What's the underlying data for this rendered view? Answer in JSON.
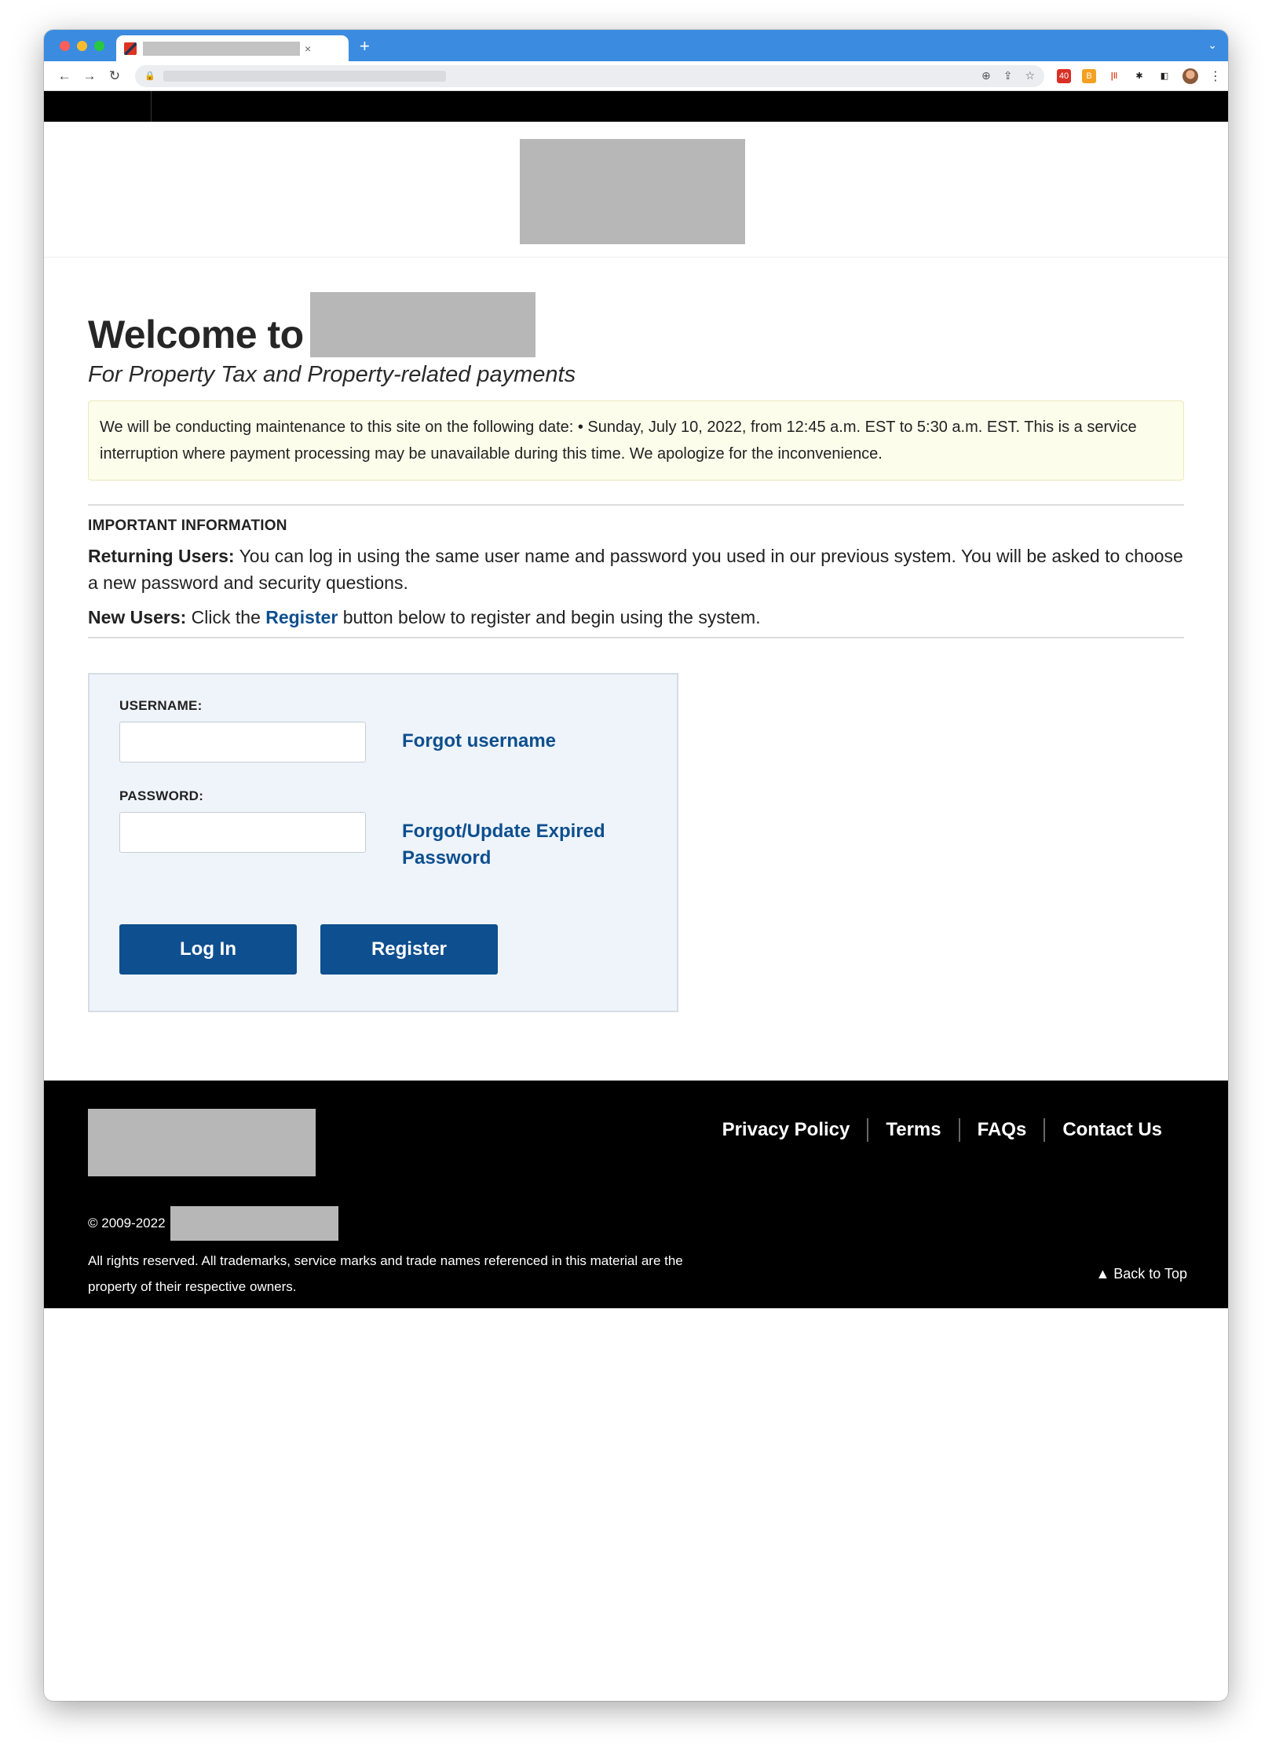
{
  "browser": {
    "new_tab": "+",
    "tab_close": "×",
    "tabstrip_menu": "⌄",
    "nav": {
      "back": "←",
      "forward": "→",
      "reload": "↻"
    },
    "lock": "🔒",
    "omni_icons": {
      "zoom": "⊕",
      "share": "⇪",
      "bookmark": "☆"
    },
    "extensions": {
      "gmail_badge": "40",
      "orange": "B",
      "red": "|‖",
      "puzzle": "✱",
      "sidepanel": "◧"
    },
    "kebab": "⋮"
  },
  "site": {
    "welcome": "Welcome to",
    "subtitle": "For Property Tax and Property-related payments",
    "alert": "We will be conducting maintenance to this site on the following date: • Sunday, July 10, 2022, from 12:45 a.m. EST to 5:30 a.m. EST. This is a service interruption where payment processing may be unavailable during this time. We apologize for the inconvenience.",
    "info_heading": "IMPORTANT INFORMATION",
    "returning_label": "Returning Users:",
    "returning_text": " You can log in using the same user name and password you used in our previous system. You will be asked to choose a new password and security questions.",
    "new_label": "New Users:",
    "new_text_1": " Click the ",
    "new_link": "Register",
    "new_text_2": " button below to register and begin using the system."
  },
  "login": {
    "username_label": "USERNAME:",
    "username_value": "",
    "password_label": "PASSWORD:",
    "password_value": "",
    "forgot_username": "Forgot username",
    "forgot_password": "Forgot/Update Expired Password",
    "login_button": "Log In",
    "register_button": "Register"
  },
  "footer": {
    "nav": [
      "Privacy Policy",
      "Terms",
      "FAQs",
      "Contact Us"
    ],
    "copyright": "© 2009-2022",
    "rights": "All rights reserved. All trademarks, service marks and trade names referenced in this material are the property of their respective owners.",
    "back_to_top": "▲ Back to Top"
  }
}
